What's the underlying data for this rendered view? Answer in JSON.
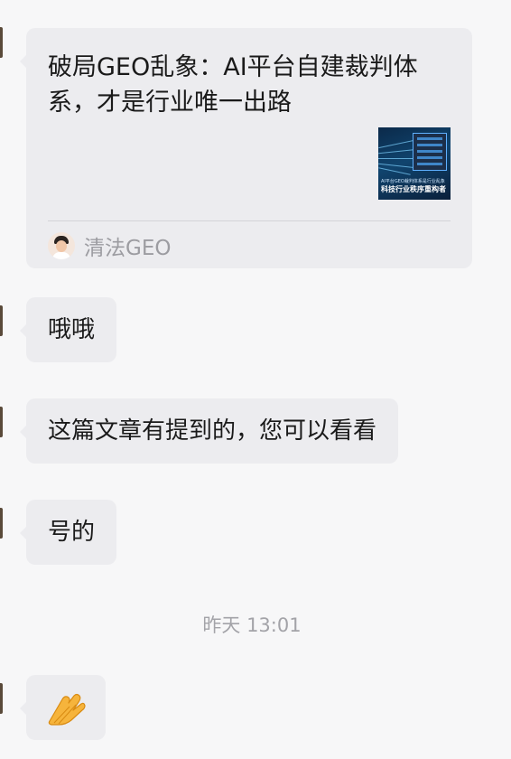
{
  "chat": {
    "link_card": {
      "title": "破局GEO乱象：AI平台自建裁判体系，才是行业唯一出路",
      "thumbnail": {
        "small_text": "AI平台GEO裁判体系是行业乱象",
        "big_text": "科技行业秩序重构者"
      },
      "source_name": "清法GEO"
    },
    "messages": [
      {
        "text": "哦哦"
      },
      {
        "text": "这篇文章有提到的，您可以看看"
      },
      {
        "text": "号的"
      }
    ],
    "timestamp": "昨天 13:01",
    "last_message": {
      "emoji": "raised-hand-emoji"
    }
  },
  "colors": {
    "background": "#f7f7f8",
    "bubble": "#ececef",
    "muted_text": "#9c9ca1"
  }
}
